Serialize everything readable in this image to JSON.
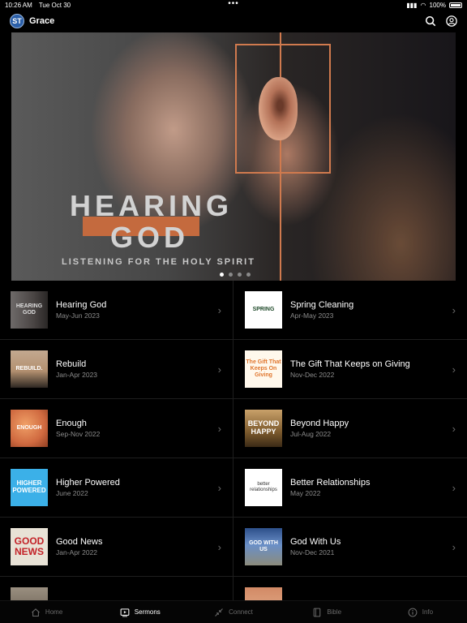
{
  "status_bar": {
    "time": "10:26 AM",
    "date": "Tue Oct 30",
    "dots": "•••",
    "battery": "100%"
  },
  "header": {
    "logo_text": "ST",
    "title": "Grace"
  },
  "hero": {
    "title_line1": "HEARING",
    "title_line2": "GOD",
    "subtitle": "LISTENING FOR THE HOLY SPIRIT",
    "slide_count": 4,
    "active_slide": 1
  },
  "sermons": [
    {
      "title": "Hearing God",
      "date": "May-Jun 2023",
      "thumb_text": "HEARING GOD"
    },
    {
      "title": "Spring Cleaning",
      "date": "Apr-May 2023",
      "thumb_text": "SPRING"
    },
    {
      "title": "Rebuild",
      "date": "Jan-Apr 2023",
      "thumb_text": "REBUILD."
    },
    {
      "title": "The Gift That Keeps on Giving",
      "date": "Nov-Dec 2022",
      "thumb_text": "The Gift That Keeps On Giving"
    },
    {
      "title": "Enough",
      "date": "Sep-Nov 2022",
      "thumb_text": "ENOUGH"
    },
    {
      "title": "Beyond Happy",
      "date": "Jul-Aug 2022",
      "thumb_text": "BEYOND HAPPY"
    },
    {
      "title": "Higher Powered",
      "date": "June 2022",
      "thumb_text": "HIGHER POWERED"
    },
    {
      "title": "Better Relationships",
      "date": "May 2022",
      "thumb_text": "better relationships"
    },
    {
      "title": "Good News",
      "date": "Jan-Apr 2022",
      "thumb_text": "GOOD NEWS"
    },
    {
      "title": "God With Us",
      "date": "Nov-Dec 2021",
      "thumb_text": "GOD WITH US"
    },
    {
      "title": "",
      "date": "",
      "thumb_text": ""
    },
    {
      "title": "",
      "date": "",
      "thumb_text": ""
    }
  ],
  "tabs": [
    {
      "label": "Home",
      "icon": "home-icon",
      "active": false
    },
    {
      "label": "Sermons",
      "icon": "play-screen-icon",
      "active": true
    },
    {
      "label": "Connect",
      "icon": "arrows-connect-icon",
      "active": false
    },
    {
      "label": "Bible",
      "icon": "book-icon",
      "active": false
    },
    {
      "label": "Info",
      "icon": "info-icon",
      "active": false
    }
  ],
  "colors": {
    "accent": "#c46a3e",
    "background": "#000000",
    "muted_text": "#8c8c8c"
  }
}
